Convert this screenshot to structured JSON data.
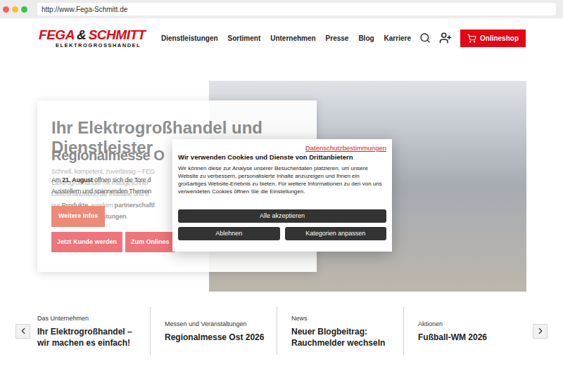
{
  "browser": {
    "url": "http://www.Fega-Schmitt.de"
  },
  "logo": {
    "part1": "FEGA",
    "ampersand": "&",
    "part2": "SCHMITT",
    "tagline": "ELEKTROGROSSHANDEL"
  },
  "nav": [
    {
      "label": "Dienstleistungen"
    },
    {
      "label": "Sortiment"
    },
    {
      "label": "Unternehmen"
    },
    {
      "label": "Presse"
    },
    {
      "label": "Blog"
    },
    {
      "label": "Karriere"
    }
  ],
  "shop_button": {
    "label": "Onlineshop"
  },
  "hero": {
    "slide_back": {
      "title": "Ihr Elektrogroßhandel und Dienstleister",
      "lines": [
        [
          {
            "text": "Schnell, kompetent, zuverlässig – FEG",
            "bold": false
          }
        ],
        [
          {
            "text": "Elektrogroßhandel mit maßgeschnei",
            "bold": false
          }
        ],
        [
          {
            "text": "Elektrohandwerk, die Industrie und d",
            "bold": false
          }
        ],
        [
          {
            "text": "nur ",
            "bold": false
          },
          {
            "text": "Produkte",
            "bold": true
          },
          {
            "text": ", sondern ",
            "bold": false
          },
          {
            "text": "partnerschaftl",
            "bold": true
          }
        ],
        [
          {
            "text": "vielfältige ",
            "bold": false
          },
          {
            "text": "Dienstleistungen",
            "bold": true
          },
          {
            "text": ".",
            "bold": false
          }
        ]
      ],
      "buttons": [
        "Jetzt Kunde werden",
        "Zum Onlines"
      ]
    },
    "slide_front": {
      "title": "Regionalmesse O",
      "lines": [
        [
          {
            "text": "Am ",
            "bold": false
          },
          {
            "text": "21. August",
            "bold": true
          },
          {
            "text": " öffnen sich die Tore d",
            "bold": false
          }
        ],
        [
          {
            "text": "Ausstellern und spannenden Themen",
            "bold": false
          }
        ]
      ],
      "button": "Weitere Infos"
    }
  },
  "cookie_dialog": {
    "link": "Datenschutzbestimmungen",
    "title": "Wir verwenden Cookies und Dienste von Drittanbietern",
    "text": "Wir können diese zur Analyse unserer Besucherdaten platzieren, um unsere Website zu verbessern, personalisierte Inhalte anzuzeigen und Ihnen ein großartiges Website-Erlebnis zu bieten. Für weitere Informationen zu den von uns verwendeten Cookies öffnen Sie die Einstellungen.",
    "accept": "Alle akzeptieren",
    "reject": "Ablehnen",
    "customize": "Kategorien anpassen"
  },
  "teasers": [
    {
      "category": "Das Unternehmen",
      "title": "Ihr Elektrogroßhandel – wir machen es einfach!"
    },
    {
      "category": "Messen und Veranstaltungen",
      "title": "Regionalmesse Ost 2026"
    },
    {
      "category": "News",
      "title": "Neuer Blogbeitrag: Rauchmelder wechseln"
    },
    {
      "category": "Aktionen",
      "title": "Fußball-WM 2026"
    }
  ]
}
